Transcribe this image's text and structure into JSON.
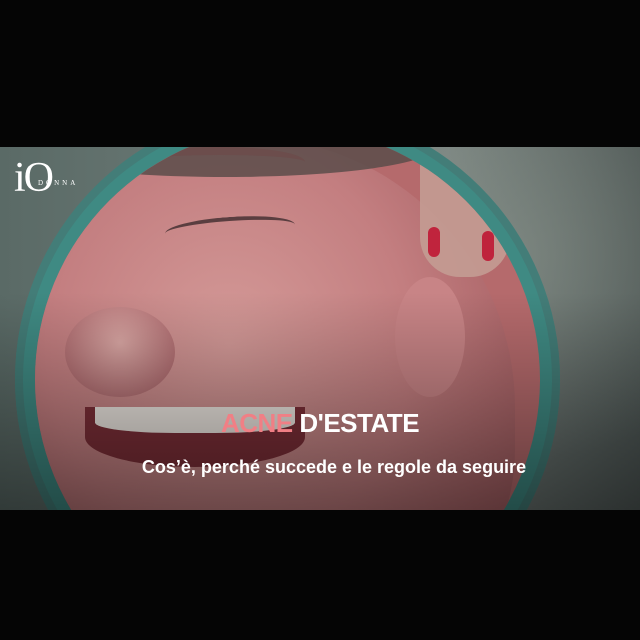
{
  "logo": {
    "main": "iO",
    "sub": "DONNA"
  },
  "headline": {
    "accent": "ACNE",
    "rest": " D'ESTATE",
    "accent_color": "#f07f85"
  },
  "subtitle": "Cos’è, perché succede e le regole da seguire",
  "colors": {
    "background": "#050505",
    "mirror_frame": "#3f8a83",
    "text": "#ffffff"
  }
}
